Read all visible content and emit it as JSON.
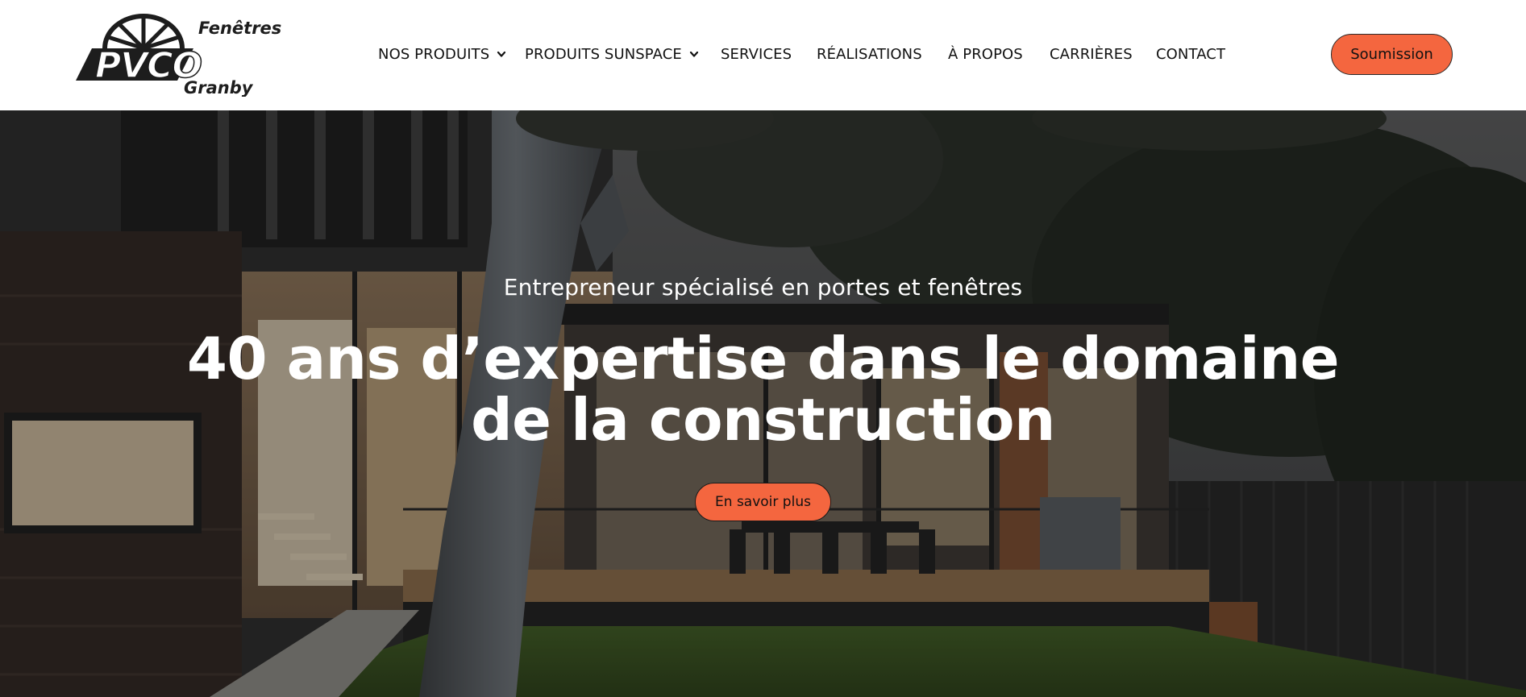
{
  "brand": {
    "logo_top": "Fenêtres",
    "logo_main": "PVCO",
    "logo_bottom": "Granby"
  },
  "nav": {
    "items": [
      {
        "label": "NOS PRODUITS",
        "dropdown": true
      },
      {
        "label": "PRODUITS SUNSPACE",
        "dropdown": true
      },
      {
        "label": "SERVICES",
        "dropdown": false
      },
      {
        "label": "RÉALISATIONS",
        "dropdown": false
      },
      {
        "label": "À PROPOS",
        "dropdown": false
      },
      {
        "label": "CARRIÈRES",
        "dropdown": false
      },
      {
        "label": "CONTACT",
        "dropdown": false
      }
    ],
    "cta_label": "Soumission"
  },
  "hero": {
    "subtitle": "Entrepreneur spécialisé en portes et fenêtres",
    "title": "40 ans d’expertise dans le domaine de la construction",
    "button_label": "En savoir plus"
  },
  "colors": {
    "accent": "#f4663f",
    "header_bg": "#ffffff",
    "text_dark": "#111111",
    "hero_text": "#ffffff"
  }
}
